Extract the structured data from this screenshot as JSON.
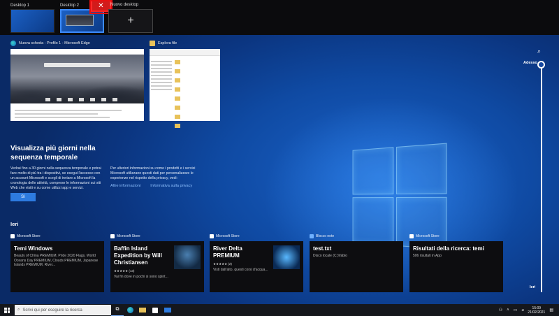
{
  "desktops": {
    "items": [
      {
        "label": "Desktop 1"
      },
      {
        "label": "Desktop 2"
      }
    ],
    "new_label": "Nuovo desktop",
    "new_symbol": "+",
    "close_symbol": "✕"
  },
  "windows": [
    {
      "title": "Nuova scheda - Profilo 1 - Microsoft Edge"
    },
    {
      "title": "Esplora file"
    }
  ],
  "promo": {
    "title": "Visualizza più giorni nella sequenza temporale",
    "body_left": "Vedrai fino a 30 giorni nella sequenza temporale e potrai fare molto di più tra i dispositivi, se esegui l'accesso con un account Microsoft e scegli di inviare a Microsoft la cronologia delle attività, comprese le informazioni sui siti Web che visiti e su come utilizzi app e servizi.",
    "body_right": "Per ulteriori informazioni su come i prodotti e i servizi Microsoft utilizzano questi dati per personalizzare le esperienze nel rispetto della privacy, vedi:",
    "link_more": "Altre informazioni",
    "link_privacy": "Informativa sulla privacy",
    "yes_button": "Sì"
  },
  "section_label": "Ieri",
  "activities": [
    {
      "source": "Microsoft Store",
      "title": "Temi Windows",
      "subtitle": "Beauty of China PREMIUM, Pride 2020 Flags, World Oceans Day PREMIUM, Clouds PREMIUM, Japanese Islands PREMIUM, River..."
    },
    {
      "source": "Microsoft Store",
      "title": "Baffin Island Expedition by Will Christiansen",
      "rating": "★★★★★ (13)",
      "subtitle": "Vai fin dove in pochi si sono spint..."
    },
    {
      "source": "Microsoft Store",
      "title": "River Delta PREMIUM",
      "rating": "★★★★★ (2)",
      "subtitle": "Visti dall'alto, questi corsi d'acqua..."
    },
    {
      "source": "Blocco note",
      "title": "test.txt",
      "subtitle": "Disco locale (C:)\\fabio"
    },
    {
      "source": "Microsoft Store",
      "title": "Risultati della ricerca: temi",
      "subtitle": "506 risultati in App"
    }
  ],
  "timeline": {
    "now_label": "Adesso",
    "yesterday_label": "Ieri"
  },
  "taskbar": {
    "search_placeholder": "Scrivi qui per eseguire la ricerca",
    "time": "15:09",
    "date": "21/02/2021"
  },
  "colors": {
    "accent": "#2d7be0",
    "close_red": "#d21b1b"
  }
}
